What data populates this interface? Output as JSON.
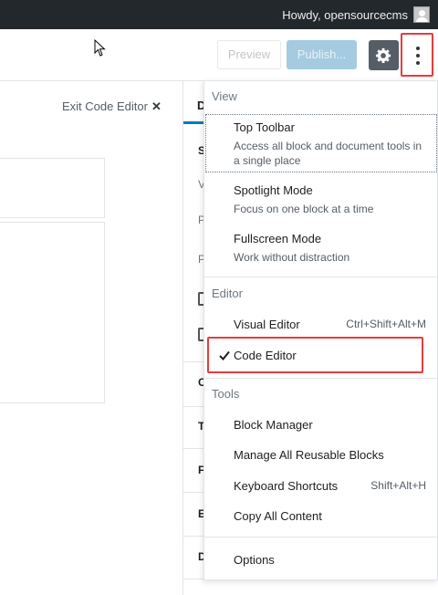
{
  "admin_bar": {
    "greeting": "Howdy, opensourcecms"
  },
  "header": {
    "preview_label": "Preview",
    "publish_label": "Publish..."
  },
  "code_editor": {
    "exit_label": "Exit Code Editor",
    "exit_icon": "✕"
  },
  "sidebar": {
    "tab_letter": "D",
    "letters": [
      "S",
      "V",
      "P",
      "P",
      "C",
      "Ta",
      "Fe",
      "Ex",
      "D"
    ]
  },
  "menu": {
    "view_title": "View",
    "top_toolbar_title": "Top Toolbar",
    "top_toolbar_desc": "Access all block and document tools in a single place",
    "spotlight_title": "Spotlight Mode",
    "spotlight_desc": "Focus on one block at a time",
    "fullscreen_title": "Fullscreen Mode",
    "fullscreen_desc": "Work without distraction",
    "editor_title": "Editor",
    "visual_editor": "Visual Editor",
    "visual_shortcut": "Ctrl+Shift+Alt+M",
    "code_editor": "Code Editor",
    "tools_title": "Tools",
    "block_manager": "Block Manager",
    "reusable_blocks": "Manage All Reusable Blocks",
    "keyboard_shortcuts": "Keyboard Shortcuts",
    "keyboard_shortcut_keys": "Shift+Alt+H",
    "copy_content": "Copy All Content",
    "options": "Options"
  },
  "colors": {
    "admin_bar": "#23282d",
    "publish_bg": "#a4cbe0",
    "settings_bg": "#555d66",
    "highlight": "#e63c3c",
    "accent": "#007cba"
  }
}
